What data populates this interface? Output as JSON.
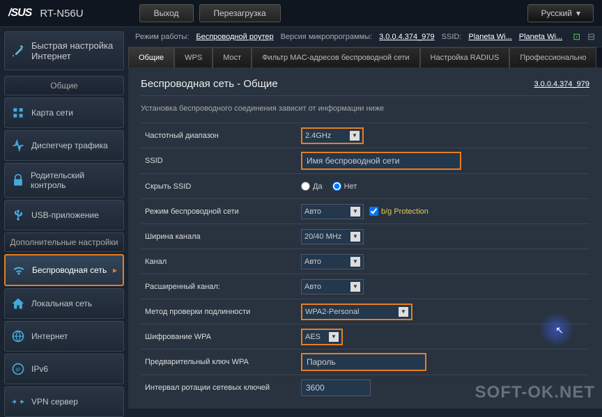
{
  "header": {
    "brand": "/SUS",
    "model": "RT-N56U",
    "logout": "Выход",
    "reboot": "Перезагрузка",
    "language": "Русский"
  },
  "infobar": {
    "mode_label": "Режим работы:",
    "mode_value": "Беспроводной роутер",
    "fw_label": "Версия микропрограммы:",
    "fw_value": "3.0.0.4.374_979",
    "ssid_label": "SSID:",
    "ssid1": "Planeta Wi...",
    "ssid2": "Planeta Wi..."
  },
  "sidebar": {
    "qis": "Быстрая настройка Интернет",
    "general_header": "Общие",
    "items_general": [
      {
        "label": "Карта сети",
        "icon": "map"
      },
      {
        "label": "Диспетчер трафика",
        "icon": "traffic"
      },
      {
        "label": "Родительский контроль",
        "icon": "lock"
      },
      {
        "label": "USB-приложение",
        "icon": "usb"
      }
    ],
    "adv_header": "Дополнительные настройки",
    "items_adv": [
      {
        "label": "Беспроводная сеть",
        "icon": "wifi",
        "active": true
      },
      {
        "label": "Локальная сеть",
        "icon": "home"
      },
      {
        "label": "Интернет",
        "icon": "globe"
      },
      {
        "label": "IPv6",
        "icon": "ip"
      },
      {
        "label": "VPN сервер",
        "icon": "vpn"
      }
    ]
  },
  "tabs": [
    {
      "label": "Общие",
      "active": true
    },
    {
      "label": "WPS"
    },
    {
      "label": "Мост"
    },
    {
      "label": "Фильтр MAC-адресов беспроводной сети"
    },
    {
      "label": "Настройка RADIUS"
    },
    {
      "label": "Профессионально"
    }
  ],
  "page": {
    "title": "Беспроводная сеть - Общие",
    "fw_link": "3.0.0.4.374_979",
    "desc": "Установка беспроводного соединения зависит от информации ниже"
  },
  "form": {
    "band_label": "Частотный диапазон",
    "band_value": "2.4GHz",
    "ssid_label": "SSID",
    "ssid_value": "Имя беспроводной сети",
    "hide_label": "Скрыть SSID",
    "hide_yes": "Да",
    "hide_no": "Нет",
    "mode_label": "Режим беспроводной сети",
    "mode_value": "Авто",
    "bgprot": "b/g Protection",
    "width_label": "Ширина канала",
    "width_value": "20/40 MHz",
    "channel_label": "Канал",
    "channel_value": "Авто",
    "ext_label": "Расширенный канал:",
    "ext_value": "Авто",
    "auth_label": "Метод проверки подлинности",
    "auth_value": "WPA2-Personal",
    "enc_label": "Шифрование WPA",
    "enc_value": "AES",
    "psk_label": "Предварительный ключ WPA",
    "psk_value": "Пароль",
    "rekey_label": "Интервал ротации сетевых ключей",
    "rekey_value": "3600"
  },
  "watermark": "SOFT-OK.NET"
}
